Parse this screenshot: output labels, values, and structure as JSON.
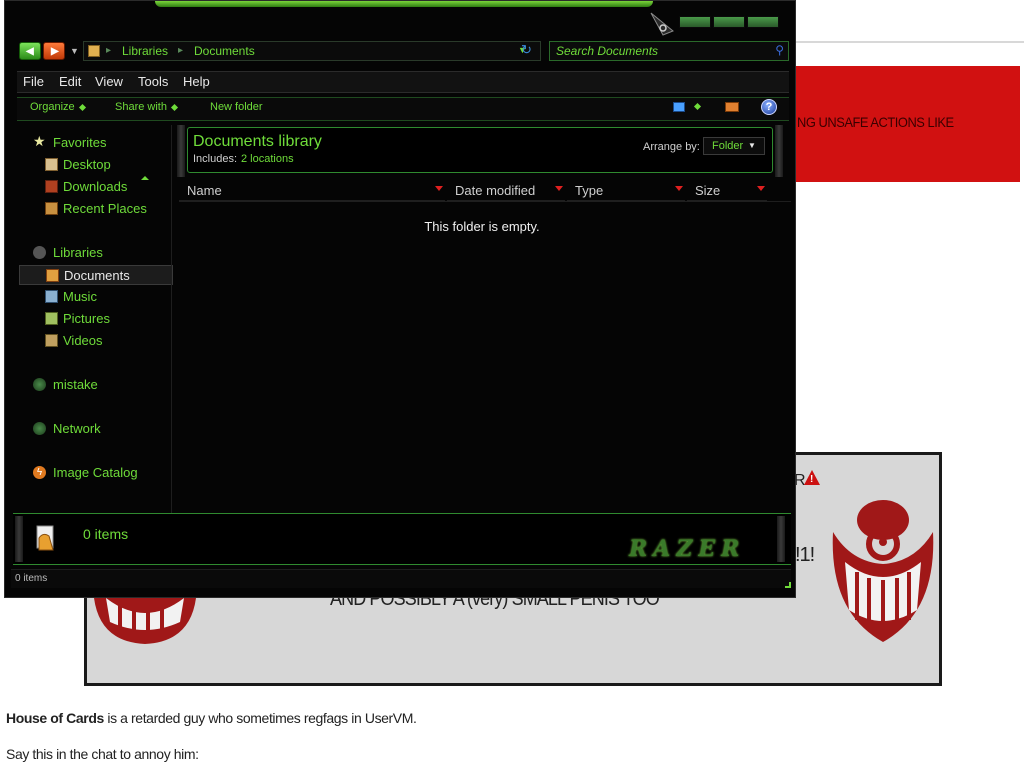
{
  "background_page": {
    "banner_text": "NG UNSAFE ACTIONS LIKE",
    "warning_fragment_1": "R",
    "warning_fragment_2": "!1!",
    "warning_fragment_3": "AND POSSIBLY A (very) SMALL PENIS TOO",
    "paragraph_bold": "House of Cards",
    "paragraph_rest": " is a retarded guy who sometimes regfags in UserVM.",
    "paragraph_2": "Say this in the chat to annoy him:"
  },
  "window": {
    "address": {
      "segments": [
        "Libraries",
        "Documents"
      ]
    },
    "search": {
      "placeholder": "Search Documents"
    },
    "menu": [
      "File",
      "Edit",
      "View",
      "Tools",
      "Help"
    ],
    "toolbar": {
      "organize": "Organize",
      "share_with": "Share with",
      "new_folder": "New folder",
      "help": "?"
    },
    "nav": {
      "favorites": "Favorites",
      "desktop": "Desktop",
      "downloads": "Downloads",
      "recent_places": "Recent Places",
      "libraries": "Libraries",
      "documents": "Documents",
      "music": "Music",
      "pictures": "Pictures",
      "videos": "Videos",
      "mistake": "mistake",
      "network": "Network",
      "image_catalog": "Image Catalog"
    },
    "library": {
      "title": "Documents library",
      "includes_label": "Includes:",
      "includes_link": "2 locations",
      "arrange_label": "Arrange by:",
      "arrange_value": "Folder"
    },
    "columns": [
      "Name",
      "Date modified",
      "Type",
      "Size"
    ],
    "empty_message": "This folder is empty.",
    "details": {
      "count": "0 items",
      "logo": "RAZER"
    },
    "status": "0 items"
  },
  "colors": {
    "accent_green": "#6fdc3a",
    "window_bg": "#050505",
    "banner_red": "#d11111"
  }
}
